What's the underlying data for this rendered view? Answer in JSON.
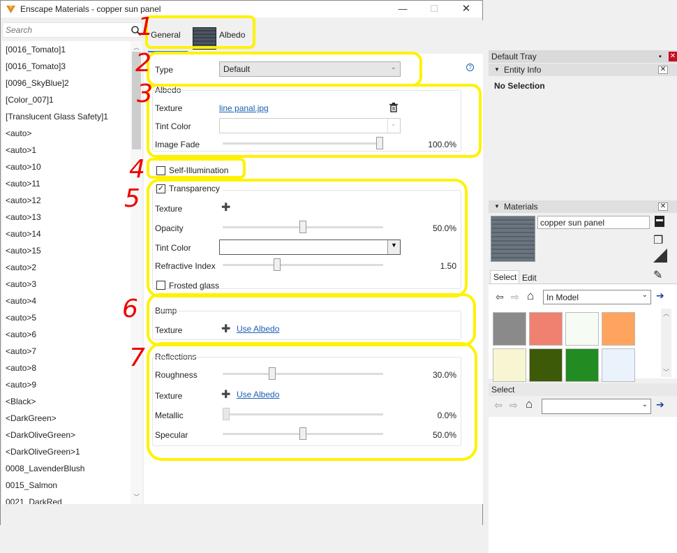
{
  "window": {
    "title": "Enscape Materials - copper sun panel",
    "min": "—",
    "max": "☐",
    "close": "✕"
  },
  "search": {
    "placeholder": "Search"
  },
  "materials": [
    "[0016_Tomato]1",
    "[0016_Tomato]3",
    "[0096_SkyBlue]2",
    "[Color_007]1",
    "[Translucent Glass Safety]1",
    "<auto>",
    "<auto>1",
    "<auto>10",
    "<auto>11",
    "<auto>12",
    "<auto>13",
    "<auto>14",
    "<auto>15",
    "<auto>2",
    "<auto>3",
    "<auto>4",
    "<auto>5",
    "<auto>6",
    "<auto>7",
    "<auto>8",
    "<auto>9",
    "<Black>",
    "<DarkGreen>",
    "<DarkOliveGreen>",
    "<DarkOliveGreen>1",
    "0008_LavenderBlush",
    "0015_Salmon",
    "0021_DarkRed"
  ],
  "tabs": {
    "general": "General",
    "albedo": "Albedo"
  },
  "type": {
    "label": "Type",
    "value": "Default",
    "help": "?"
  },
  "albedo": {
    "title": "Albedo",
    "texture_label": "Texture",
    "texture_file": "line panal.jpg",
    "tint_label": "Tint Color",
    "fade_label": "Image Fade",
    "fade_value": "100.0%",
    "fade_pct": 100
  },
  "self_illumination": {
    "label": "Self-Illumination",
    "checked": false
  },
  "transparency": {
    "label": "Transparency",
    "checked": true,
    "texture_label": "Texture",
    "opacity_label": "Opacity",
    "opacity_value": "50.0%",
    "opacity_pct": 50,
    "tint_label": "Tint Color",
    "refr_label": "Refractive Index",
    "refr_value": "1.50",
    "refr_pct": 33,
    "frosted_label": "Frosted glass"
  },
  "bump": {
    "title": "Bump",
    "texture_label": "Texture",
    "use_albedo": "Use Albedo"
  },
  "reflections": {
    "title": "Reflections",
    "rough_label": "Roughness",
    "rough_value": "30.0%",
    "rough_pct": 30,
    "texture_label": "Texture",
    "use_albedo": "Use Albedo",
    "metal_label": "Metallic",
    "metal_value": "0.0%",
    "metal_pct": 0,
    "spec_label": "Specular",
    "spec_value": "50.0%",
    "spec_pct": 50
  },
  "annotations": [
    "1",
    "2",
    "3",
    "4",
    "5",
    "6",
    "7"
  ],
  "tray": {
    "title": "Default Tray",
    "pin": "▪",
    "entity": {
      "title": "Entity Info",
      "status": "No Selection"
    },
    "materials_panel": {
      "title": "Materials",
      "name": "copper sun panel",
      "tab_select": "Select",
      "tab_edit": "Edit",
      "collection": "In Model"
    },
    "swatches": [
      "#8a8a8a",
      "#f08070",
      "#f6fbf3",
      "#ffa45e",
      "#f8f6d2",
      "#3c5a08",
      "#228b22",
      "#eaf2fb"
    ],
    "select": {
      "title": "Select",
      "collection": ""
    }
  }
}
